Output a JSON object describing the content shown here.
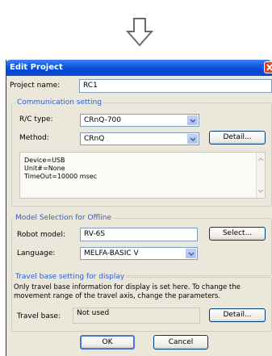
{
  "window": {
    "title": "Edit Project"
  },
  "project": {
    "name_label": "Project name:",
    "name_value": "RC1"
  },
  "communication": {
    "group_title": "Communication setting",
    "rc_type_label": "R/C type:",
    "rc_type_value": "CRnQ-700",
    "method_label": "Method:",
    "method_value": "CRnQ",
    "detail_button": "Detail...",
    "info_lines": [
      "Device=USB",
      "Unit#=None",
      "TimeOut=10000 msec"
    ]
  },
  "model_selection": {
    "group_title": "Model Selection for Offline",
    "robot_model_label": "Robot model:",
    "robot_model_value": "RV-6S",
    "select_button": "Select...",
    "language_label": "Language:",
    "language_value": "MELFA-BASIC V"
  },
  "travel_base": {
    "group_title": "Travel base setting for display",
    "description": "Only travel base information for display is set here. To change the movement range of the travel axis, change the parameters.",
    "label": "Travel base:",
    "value": "Not used",
    "detail_button": "Detail..."
  },
  "footer": {
    "ok_button": "OK",
    "cancel_button": "Cancel"
  }
}
